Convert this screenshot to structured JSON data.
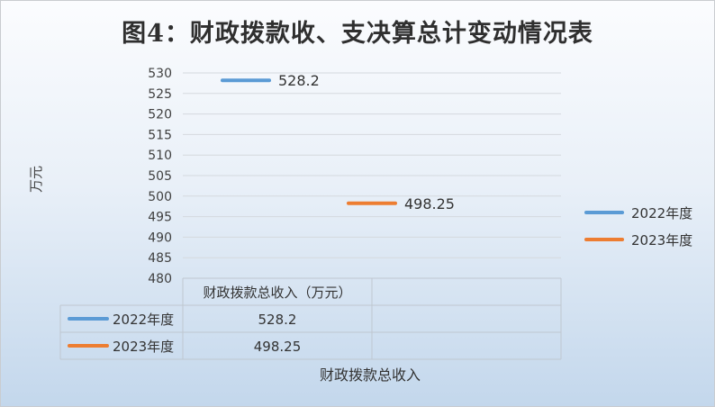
{
  "title": "图4：财政拨款收、支决算总计变动情况表",
  "chart_data": {
    "type": "bar",
    "title": "图4：财政拨款收、支决算总计变动情况表",
    "ylabel": "万元",
    "xlabel": "财政拨款总收入",
    "categories": [
      "财政拨款总收入（万元）"
    ],
    "series": [
      {
        "name": "2022年度",
        "values": [
          528.2
        ],
        "color": "#5b9bd5"
      },
      {
        "name": "2023年度",
        "values": [
          498.25
        ],
        "color": "#ed7d31"
      }
    ],
    "ylim": [
      480,
      530
    ],
    "yticks": [
      480,
      485,
      490,
      495,
      500,
      505,
      510,
      515,
      520,
      525,
      530
    ],
    "data_labels": [
      "528.2",
      "498.25"
    ],
    "grid": true,
    "legend_position": "right",
    "data_table": {
      "header": "财政拨款总收入（万元）",
      "rows": [
        {
          "series": "2022年度",
          "value": "528.2"
        },
        {
          "series": "2023年度",
          "value": "498.25"
        }
      ]
    }
  }
}
